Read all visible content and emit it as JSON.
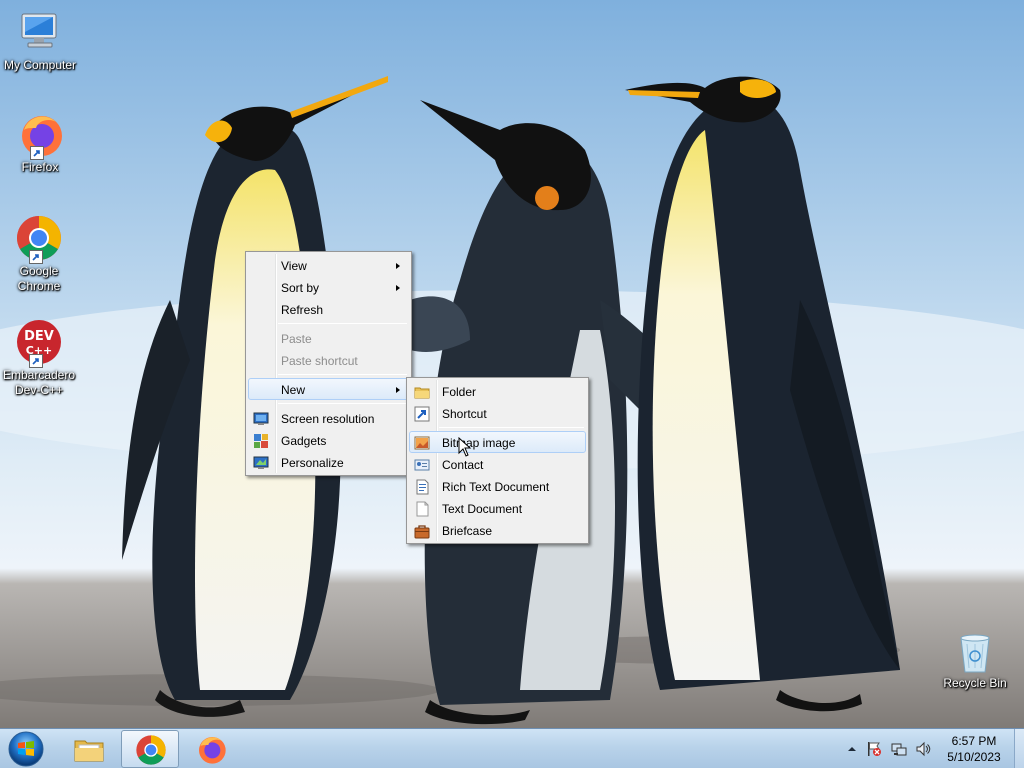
{
  "desktop": {
    "icons": [
      {
        "label": "My Computer",
        "icon": "computer-icon"
      },
      {
        "label": "Firefox",
        "icon": "firefox-icon"
      },
      {
        "label": "Google Chrome",
        "icon": "chrome-icon"
      },
      {
        "label": "Embarcadero Dev-C++",
        "icon": "devcpp-icon",
        "badge": "DEV C++"
      },
      {
        "label": "Recycle Bin",
        "icon": "recycle-bin-icon"
      }
    ]
  },
  "context_menu": {
    "items": [
      {
        "label": "View",
        "submenu": true
      },
      {
        "label": "Sort by",
        "submenu": true
      },
      {
        "label": "Refresh"
      },
      {
        "label": "Paste",
        "disabled": true
      },
      {
        "label": "Paste shortcut",
        "disabled": true
      },
      {
        "label": "New",
        "submenu": true,
        "highlighted": true
      },
      {
        "label": "Screen resolution",
        "icon": "screen-resolution-icon"
      },
      {
        "label": "Gadgets",
        "icon": "gadgets-icon"
      },
      {
        "label": "Personalize",
        "icon": "personalize-icon"
      }
    ]
  },
  "new_submenu": {
    "items": [
      {
        "label": "Folder",
        "icon": "folder-icon"
      },
      {
        "label": "Shortcut",
        "icon": "shortcut-icon"
      },
      {
        "label": "Bitmap image",
        "icon": "bitmap-image-icon",
        "highlighted": true
      },
      {
        "label": "Contact",
        "icon": "contact-icon"
      },
      {
        "label": "Rich Text Document",
        "icon": "rich-text-icon"
      },
      {
        "label": "Text Document",
        "icon": "text-document-icon"
      },
      {
        "label": "Briefcase",
        "icon": "briefcase-icon"
      }
    ]
  },
  "taskbar": {
    "pinned": [
      {
        "name": "file-explorer",
        "icon": "folder-library-icon"
      },
      {
        "name": "google-chrome",
        "icon": "chrome-icon",
        "active": true
      },
      {
        "name": "firefox",
        "icon": "firefox-icon"
      }
    ],
    "tray_icons": [
      "show-hidden-icons-icon",
      "action-center-flag-icon",
      "network-icon",
      "volume-icon"
    ],
    "clock": {
      "time": "6:57 PM",
      "date": "5/10/2023"
    }
  },
  "colors": {
    "taskbar_top": "#cfe3f5",
    "menu_background": "#f0f0f0",
    "menu_highlight": "#dceaf9",
    "sky": "#9fc3e4",
    "sand": "#8c8580"
  }
}
